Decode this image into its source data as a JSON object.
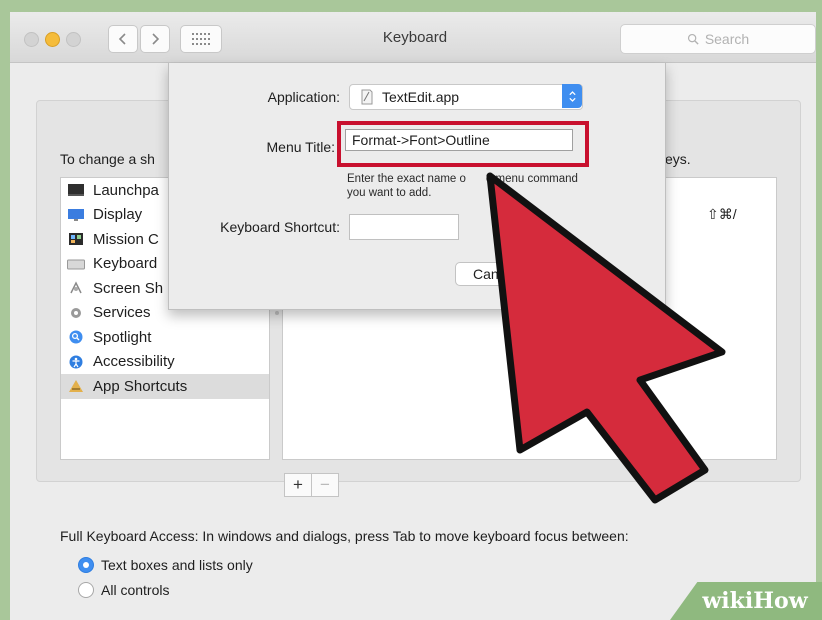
{
  "window": {
    "title": "Keyboard",
    "search_placeholder": "Search"
  },
  "main": {
    "instruction": "To change a sh",
    "instruction_end": "eys.",
    "categories": [
      {
        "label": "Launchpa",
        "icon": "launchpad-icon"
      },
      {
        "label": "Display",
        "icon": "display-icon"
      },
      {
        "label": "Mission C",
        "icon": "mission-control-icon"
      },
      {
        "label": "Keyboard",
        "icon": "keyboard-icon"
      },
      {
        "label": "Screen Sh",
        "icon": "screenshot-icon"
      },
      {
        "label": "Services",
        "icon": "gear-icon"
      },
      {
        "label": "Spotlight",
        "icon": "spotlight-icon"
      },
      {
        "label": "Accessibility",
        "icon": "accessibility-icon"
      },
      {
        "label": "App Shortcuts",
        "icon": "app-shortcuts-icon",
        "selected": true
      }
    ],
    "shortcut_keys": "⇧⌘/",
    "add_label": "+",
    "remove_label": "−",
    "full_keyboard_access": "Full Keyboard Access: In windows and dialogs, press Tab to move keyboard focus between:",
    "radio_options": [
      {
        "label": "Text boxes and lists only",
        "selected": true
      },
      {
        "label": "All controls",
        "selected": false
      }
    ]
  },
  "sheet": {
    "application_label": "Application:",
    "application_value": "TextEdit.app",
    "menu_title_label": "Menu Title:",
    "menu_title_value": "Format->Font>Outline",
    "hint": "Enter the exact name o",
    "hint_line2": "you want to add.",
    "hint_right": "e menu command",
    "shortcut_label": "Keyboard Shortcut:",
    "shortcut_value": "",
    "cancel_label": "Can"
  },
  "watermark": "wikiHow",
  "colors": {
    "annotation_red": "#c8102e",
    "accent_blue": "#3f8ef0",
    "minimize_yellow": "#f5bc3b"
  }
}
